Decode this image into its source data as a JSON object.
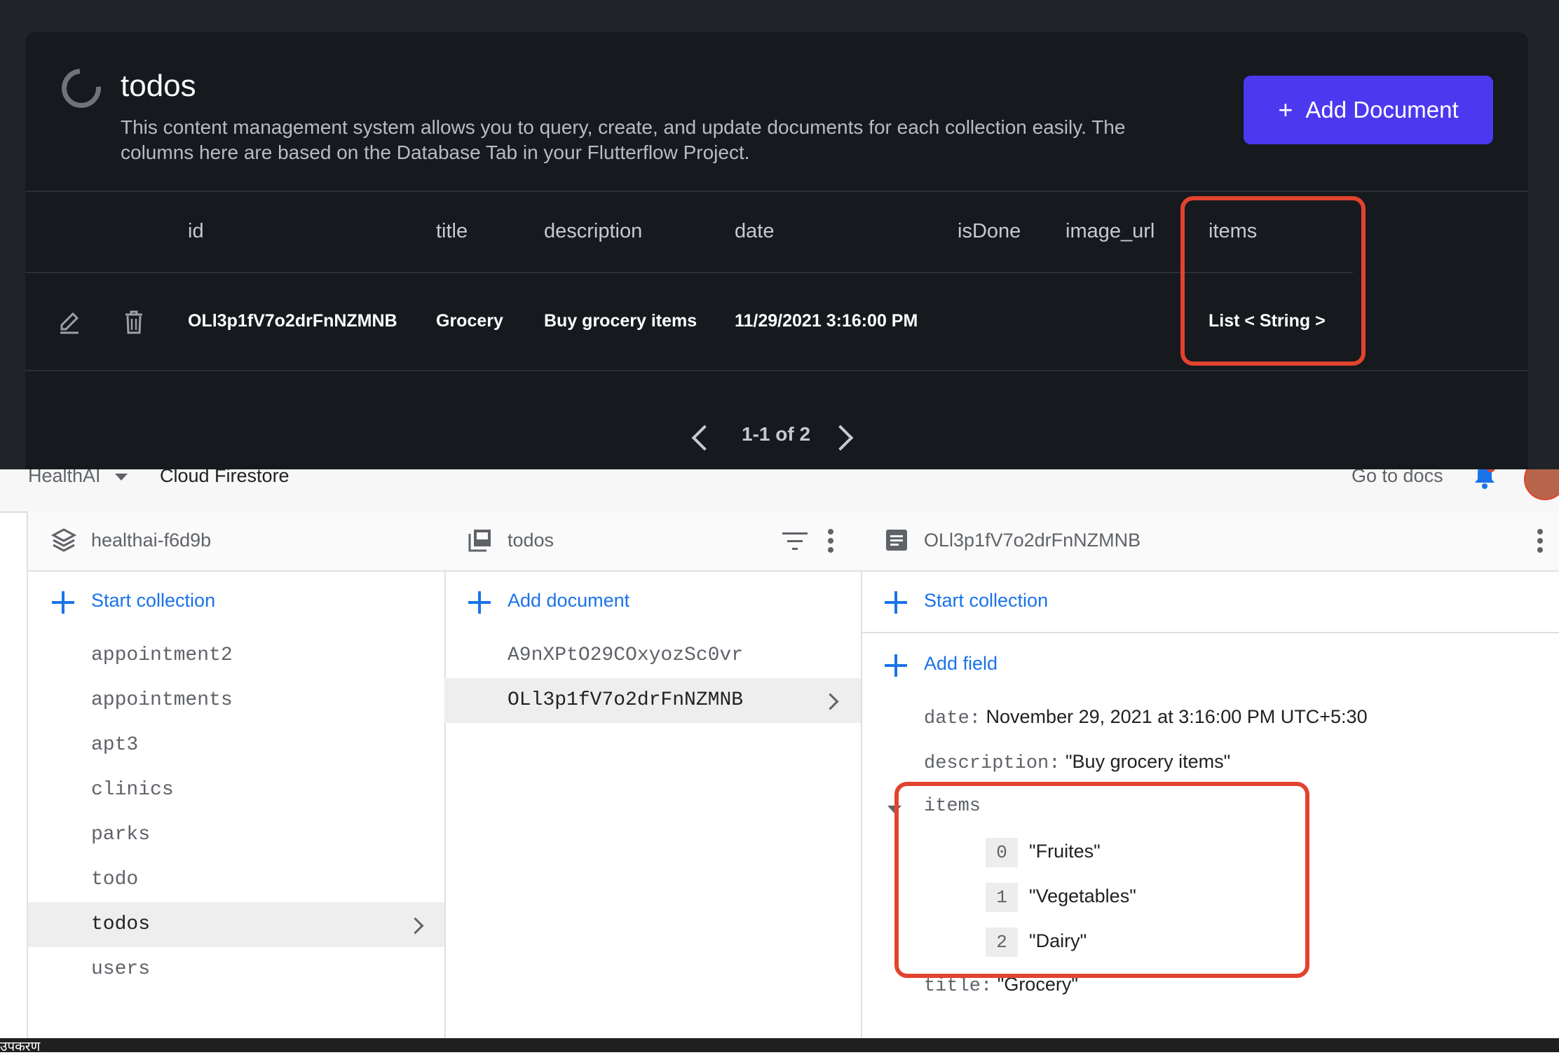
{
  "cms": {
    "title": "todos",
    "description": "This content management system allows you to query, create, and update documents for each collection easily. The columns here are based on the Database Tab in your Flutterflow Project.",
    "add_button": "Add Document",
    "columns": [
      "id",
      "title",
      "description",
      "date",
      "isDone",
      "image_url",
      "items"
    ],
    "row": {
      "id": "OLl3p1fV7o2drFnNZMNB",
      "title": "Grocery",
      "description": "Buy grocery items",
      "date": "11/29/2021 3:16:00 PM",
      "isDone": "",
      "image_url": "",
      "items": "List < String >"
    },
    "pagination": "1-1 of 2"
  },
  "appbar": {
    "project": "HealthAI",
    "product": "Cloud Firestore",
    "docs_link": "Go to docs"
  },
  "root_panel": {
    "title": "healthai-f6d9b",
    "action": "Start collection",
    "collections": [
      "appointment2",
      "appointments",
      "apt3",
      "clinics",
      "parks",
      "todo",
      "todos",
      "users"
    ],
    "selected": "todos"
  },
  "collection_panel": {
    "title": "todos",
    "action": "Add document",
    "documents": [
      "A9nXPtO29COxyozSc0vr",
      "OLl3p1fV7o2drFnNZMNB"
    ],
    "selected": "OLl3p1fV7o2drFnNZMNB"
  },
  "document_panel": {
    "title": "OLl3p1fV7o2drFnNZMNB",
    "start_collection": "Start collection",
    "add_field": "Add field",
    "fields": {
      "date_key": "date:",
      "date_value": "November 29, 2021 at 3:16:00 PM UTC+5:30",
      "description_key": "description:",
      "description_value": "\"Buy grocery items\"",
      "items_key": "items",
      "items": [
        {
          "index": "0",
          "value": "\"Fruites\""
        },
        {
          "index": "1",
          "value": "\"Vegetables\""
        },
        {
          "index": "2",
          "value": "\"Dairy\""
        }
      ],
      "title_key": "title:",
      "title_value": "\"Grocery\""
    }
  },
  "footer": {
    "text": "उपकरण"
  },
  "colors": {
    "accent": "#4b39ef",
    "link": "#1a73e8",
    "highlight": "#e2432e",
    "cms_bg": "#16191d"
  },
  "icons": [
    "loading-ring-icon",
    "plus-icon",
    "edit-pencil-icon",
    "trash-icon",
    "chevron-left-icon",
    "chevron-right-icon",
    "dropdown-caret-icon",
    "bell-icon",
    "avatar",
    "firebase-stack-icon",
    "collection-icon",
    "filter-icon",
    "more-vert-icon",
    "document-icon",
    "expand-caret-icon"
  ]
}
